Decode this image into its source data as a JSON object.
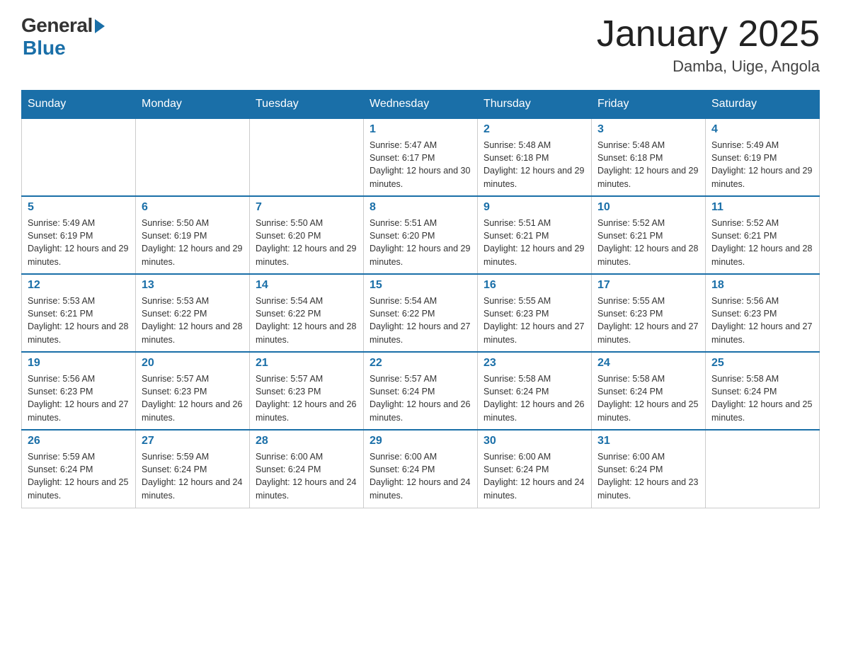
{
  "header": {
    "logo_general": "General",
    "logo_blue": "Blue",
    "title": "January 2025",
    "subtitle": "Damba, Uige, Angola"
  },
  "days_of_week": [
    "Sunday",
    "Monday",
    "Tuesday",
    "Wednesday",
    "Thursday",
    "Friday",
    "Saturday"
  ],
  "weeks": [
    [
      {
        "day": "",
        "info": ""
      },
      {
        "day": "",
        "info": ""
      },
      {
        "day": "",
        "info": ""
      },
      {
        "day": "1",
        "info": "Sunrise: 5:47 AM\nSunset: 6:17 PM\nDaylight: 12 hours and 30 minutes."
      },
      {
        "day": "2",
        "info": "Sunrise: 5:48 AM\nSunset: 6:18 PM\nDaylight: 12 hours and 29 minutes."
      },
      {
        "day": "3",
        "info": "Sunrise: 5:48 AM\nSunset: 6:18 PM\nDaylight: 12 hours and 29 minutes."
      },
      {
        "day": "4",
        "info": "Sunrise: 5:49 AM\nSunset: 6:19 PM\nDaylight: 12 hours and 29 minutes."
      }
    ],
    [
      {
        "day": "5",
        "info": "Sunrise: 5:49 AM\nSunset: 6:19 PM\nDaylight: 12 hours and 29 minutes."
      },
      {
        "day": "6",
        "info": "Sunrise: 5:50 AM\nSunset: 6:19 PM\nDaylight: 12 hours and 29 minutes."
      },
      {
        "day": "7",
        "info": "Sunrise: 5:50 AM\nSunset: 6:20 PM\nDaylight: 12 hours and 29 minutes."
      },
      {
        "day": "8",
        "info": "Sunrise: 5:51 AM\nSunset: 6:20 PM\nDaylight: 12 hours and 29 minutes."
      },
      {
        "day": "9",
        "info": "Sunrise: 5:51 AM\nSunset: 6:21 PM\nDaylight: 12 hours and 29 minutes."
      },
      {
        "day": "10",
        "info": "Sunrise: 5:52 AM\nSunset: 6:21 PM\nDaylight: 12 hours and 28 minutes."
      },
      {
        "day": "11",
        "info": "Sunrise: 5:52 AM\nSunset: 6:21 PM\nDaylight: 12 hours and 28 minutes."
      }
    ],
    [
      {
        "day": "12",
        "info": "Sunrise: 5:53 AM\nSunset: 6:21 PM\nDaylight: 12 hours and 28 minutes."
      },
      {
        "day": "13",
        "info": "Sunrise: 5:53 AM\nSunset: 6:22 PM\nDaylight: 12 hours and 28 minutes."
      },
      {
        "day": "14",
        "info": "Sunrise: 5:54 AM\nSunset: 6:22 PM\nDaylight: 12 hours and 28 minutes."
      },
      {
        "day": "15",
        "info": "Sunrise: 5:54 AM\nSunset: 6:22 PM\nDaylight: 12 hours and 27 minutes."
      },
      {
        "day": "16",
        "info": "Sunrise: 5:55 AM\nSunset: 6:23 PM\nDaylight: 12 hours and 27 minutes."
      },
      {
        "day": "17",
        "info": "Sunrise: 5:55 AM\nSunset: 6:23 PM\nDaylight: 12 hours and 27 minutes."
      },
      {
        "day": "18",
        "info": "Sunrise: 5:56 AM\nSunset: 6:23 PM\nDaylight: 12 hours and 27 minutes."
      }
    ],
    [
      {
        "day": "19",
        "info": "Sunrise: 5:56 AM\nSunset: 6:23 PM\nDaylight: 12 hours and 27 minutes."
      },
      {
        "day": "20",
        "info": "Sunrise: 5:57 AM\nSunset: 6:23 PM\nDaylight: 12 hours and 26 minutes."
      },
      {
        "day": "21",
        "info": "Sunrise: 5:57 AM\nSunset: 6:23 PM\nDaylight: 12 hours and 26 minutes."
      },
      {
        "day": "22",
        "info": "Sunrise: 5:57 AM\nSunset: 6:24 PM\nDaylight: 12 hours and 26 minutes."
      },
      {
        "day": "23",
        "info": "Sunrise: 5:58 AM\nSunset: 6:24 PM\nDaylight: 12 hours and 26 minutes."
      },
      {
        "day": "24",
        "info": "Sunrise: 5:58 AM\nSunset: 6:24 PM\nDaylight: 12 hours and 25 minutes."
      },
      {
        "day": "25",
        "info": "Sunrise: 5:58 AM\nSunset: 6:24 PM\nDaylight: 12 hours and 25 minutes."
      }
    ],
    [
      {
        "day": "26",
        "info": "Sunrise: 5:59 AM\nSunset: 6:24 PM\nDaylight: 12 hours and 25 minutes."
      },
      {
        "day": "27",
        "info": "Sunrise: 5:59 AM\nSunset: 6:24 PM\nDaylight: 12 hours and 24 minutes."
      },
      {
        "day": "28",
        "info": "Sunrise: 6:00 AM\nSunset: 6:24 PM\nDaylight: 12 hours and 24 minutes."
      },
      {
        "day": "29",
        "info": "Sunrise: 6:00 AM\nSunset: 6:24 PM\nDaylight: 12 hours and 24 minutes."
      },
      {
        "day": "30",
        "info": "Sunrise: 6:00 AM\nSunset: 6:24 PM\nDaylight: 12 hours and 24 minutes."
      },
      {
        "day": "31",
        "info": "Sunrise: 6:00 AM\nSunset: 6:24 PM\nDaylight: 12 hours and 23 minutes."
      },
      {
        "day": "",
        "info": ""
      }
    ]
  ]
}
